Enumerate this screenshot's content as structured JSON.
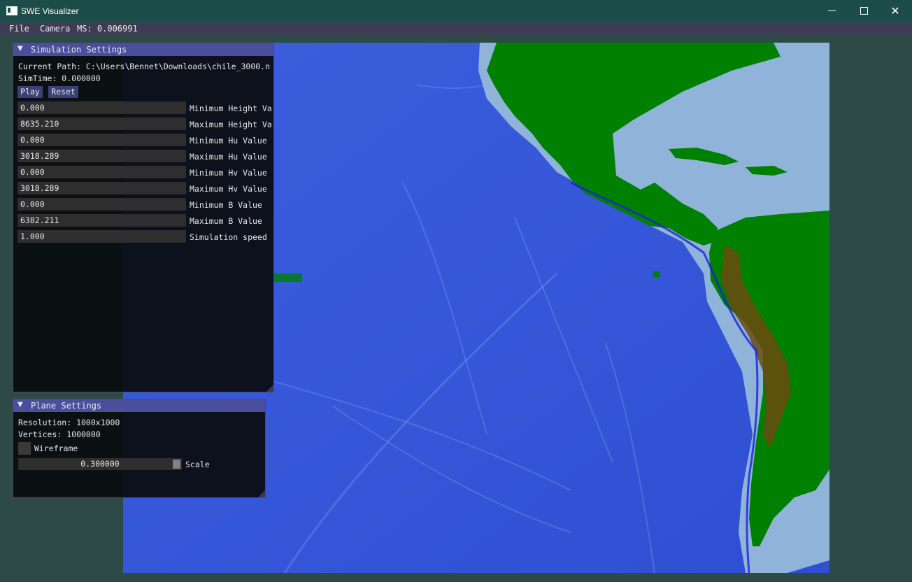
{
  "window": {
    "title": "SWE Visualizer",
    "icon": "app-icon",
    "controls": [
      "minimize-icon",
      "maximize-icon",
      "close-icon"
    ],
    "close_glyph": "✕"
  },
  "menubar": {
    "file": "File",
    "camera": "Camera",
    "ms": "MS: 0.006991"
  },
  "simulation_settings": {
    "title": "Simulation Settings",
    "collapse_glyph": "▼",
    "current_path": "Current Path: C:\\Users\\Bennet\\Downloads\\chile_3000.n",
    "sim_time": "SimTime: 0.000000",
    "play_label": "Play",
    "reset_label": "Reset",
    "rows": [
      {
        "value": "0.000",
        "label": "Minimum Height Va"
      },
      {
        "value": "8635.210",
        "label": "Maximum Height Va"
      },
      {
        "value": "0.000",
        "label": "Minimum Hu Value"
      },
      {
        "value": "3018.289",
        "label": "Maximum Hu Value"
      },
      {
        "value": "0.000",
        "label": "Minimum Hv Value"
      },
      {
        "value": "3018.289",
        "label": "Maximum Hv Value"
      },
      {
        "value": "0.000",
        "label": "Minimum B Value"
      },
      {
        "value": "6382.211",
        "label": "Maximum B Value"
      },
      {
        "value": "1.000",
        "label": "Simulation speed"
      }
    ]
  },
  "plane_settings": {
    "title": "Plane Settings",
    "collapse_glyph": "▼",
    "resolution": "Resolution: 1000x1000",
    "vertices": "Vertices: 1000000",
    "wireframe_label": "Wireframe",
    "scale_value": "0.300000",
    "scale_label": "Scale",
    "scale_level": 0.3
  },
  "colors": {
    "ocean": "#3556d6",
    "shelf": "#8fb3d9",
    "land": "#008000",
    "highland": "#6b4a10",
    "panel_header": "#4a4f9c",
    "titlebar": "#1d4d4a"
  }
}
